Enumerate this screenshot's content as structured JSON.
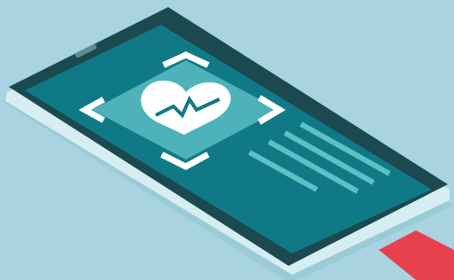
{
  "illustration": {
    "subject": "smartphone-health-app",
    "icons": [
      "heart-icon",
      "heartbeat-pulse-icon",
      "scan-frame-corners-icon"
    ]
  },
  "colors": {
    "background": "#A9D3E0",
    "phone_body": "#1C4850",
    "phone_shadow": "#9CCBD8",
    "phone_edge": "#D6EEF2",
    "screen": "#0F7A86",
    "card": "#4DB2BA",
    "heart": "#FFFFFF",
    "pulse": "#0F7A86",
    "frame_corners": "#FFFFFF",
    "text_lines": "#5CC1C4",
    "speaker": "#5C8C94",
    "strap": "#E8414E"
  }
}
